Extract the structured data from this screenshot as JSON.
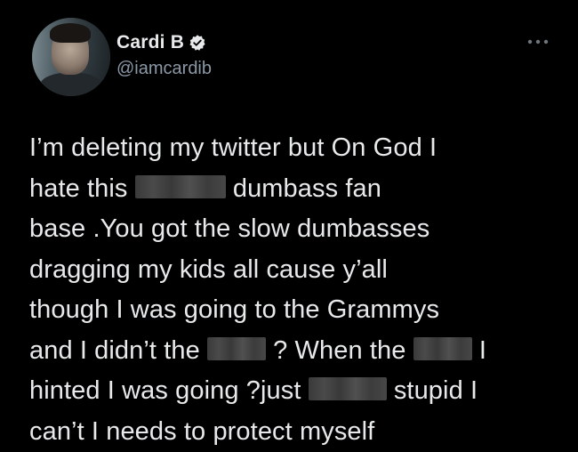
{
  "author": {
    "display_name": "Cardi B",
    "handle": "@iamcardib",
    "verified": true,
    "avatar_icon": "profile-photo"
  },
  "menu": {
    "icon": "more-options-icon"
  },
  "tweet": {
    "lines": [
      [
        "I’m deleting my twitter but On God I"
      ],
      [
        "hate this ",
        "[redacted]",
        " dumbass fan"
      ],
      [
        "base .You got the slow dumbasses"
      ],
      [
        "dragging my kids all cause y’all"
      ],
      [
        "though I was going to the Grammys"
      ],
      [
        "and I didn’t the ",
        "[redacted]",
        " ? When the ",
        "[redacted]",
        " I"
      ],
      [
        "hinted I was going ?just ",
        "[redacted]",
        " stupid I"
      ],
      [
        "can’t I needs to protect myself"
      ]
    ]
  },
  "colors": {
    "background": "#000000",
    "primary_text": "#e7e9ea",
    "secondary_text": "#8b98a5",
    "redaction": "#444444"
  }
}
